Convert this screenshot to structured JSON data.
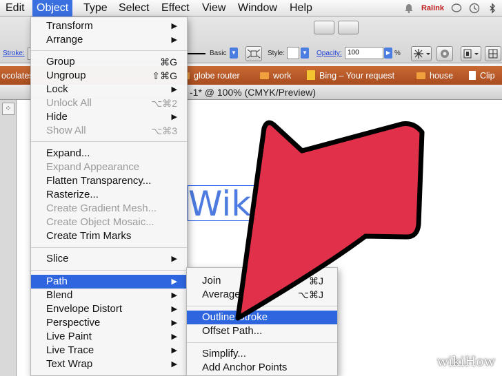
{
  "menubar": {
    "items": [
      "Edit",
      "Object",
      "Type",
      "Select",
      "Effect",
      "View",
      "Window",
      "Help"
    ],
    "tray_text": "Ralink"
  },
  "controlbar": {
    "stroke_label": "Stroke:",
    "brush_value": "Basic",
    "style_label": "Style:",
    "opacity_label": "Opacity:",
    "opacity_value": "100",
    "percent": "%"
  },
  "bookmarks": [
    {
      "label": "ocolates"
    },
    {
      "label": "globe router"
    },
    {
      "label": "work"
    },
    {
      "label": "Bing – Your request"
    },
    {
      "label": "house"
    },
    {
      "label": "Clip"
    }
  ],
  "document": {
    "title": "‑1* @ 100% (CMYK/Preview)",
    "artboard_text": "WikiH"
  },
  "object_menu": {
    "transform": "Transform",
    "arrange": "Arrange",
    "group": "Group",
    "group_sc": "⌘G",
    "ungroup": "Ungroup",
    "ungroup_sc": "⇧⌘G",
    "lock": "Lock",
    "unlock_all": "Unlock All",
    "unlock_all_sc": "⌥⌘2",
    "hide": "Hide",
    "show_all": "Show All",
    "show_all_sc": "⌥⌘3",
    "expand": "Expand...",
    "expand_appearance": "Expand Appearance",
    "flatten": "Flatten Transparency...",
    "rasterize": "Rasterize...",
    "gradient_mesh": "Create Gradient Mesh...",
    "object_mosaic": "Create Object Mosaic...",
    "trim_marks": "Create Trim Marks",
    "slice": "Slice",
    "path": "Path",
    "blend": "Blend",
    "envelope": "Envelope Distort",
    "perspective": "Perspective",
    "live_paint": "Live Paint",
    "live_trace": "Live Trace",
    "text_wrap": "Text Wrap"
  },
  "path_submenu": {
    "join": "Join",
    "join_sc": "⌘J",
    "average": "Average...",
    "average_sc": "⌥⌘J",
    "outline_stroke": "Outline Stroke",
    "offset_path": "Offset Path...",
    "simplify": "Simplify...",
    "add_anchor": "Add Anchor Points"
  },
  "watermark": "wikiHow",
  "colors": {
    "menu_highlight": "#2f66e0",
    "arrow_red": "#e0304a",
    "selection_blue": "#4d7be0"
  }
}
